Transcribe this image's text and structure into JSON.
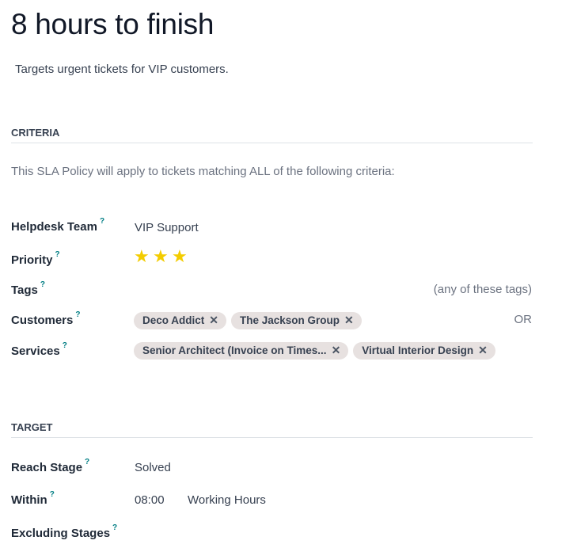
{
  "header": {
    "title": "8 hours to finish",
    "description": "Targets urgent tickets for VIP customers."
  },
  "criteria": {
    "heading": "CRITERIA",
    "intro": "This SLA Policy will apply to tickets matching ALL of the following criteria:",
    "helpdesk_team": {
      "label": "Helpdesk Team",
      "help": "?",
      "value": "VIP Support"
    },
    "priority": {
      "label": "Priority",
      "help": "?",
      "stars": 3,
      "star_glyph": "★",
      "star_color": "#f3cc00"
    },
    "tags": {
      "label": "Tags",
      "help": "?",
      "hint": "(any of these tags)"
    },
    "customers": {
      "label": "Customers",
      "help": "?",
      "hint": "OR",
      "items": [
        "Deco Addict",
        "The Jackson Group"
      ]
    },
    "services": {
      "label": "Services",
      "help": "?",
      "items": [
        "Senior Architect (Invoice on Times...",
        "Virtual Interior Design"
      ]
    },
    "remove_glyph": "✕"
  },
  "target": {
    "heading": "TARGET",
    "reach_stage": {
      "label": "Reach Stage",
      "help": "?",
      "value": "Solved"
    },
    "within": {
      "label": "Within",
      "help": "?",
      "time": "08:00",
      "unit": "Working Hours"
    },
    "excluding_stages": {
      "label": "Excluding Stages",
      "help": "?"
    }
  }
}
